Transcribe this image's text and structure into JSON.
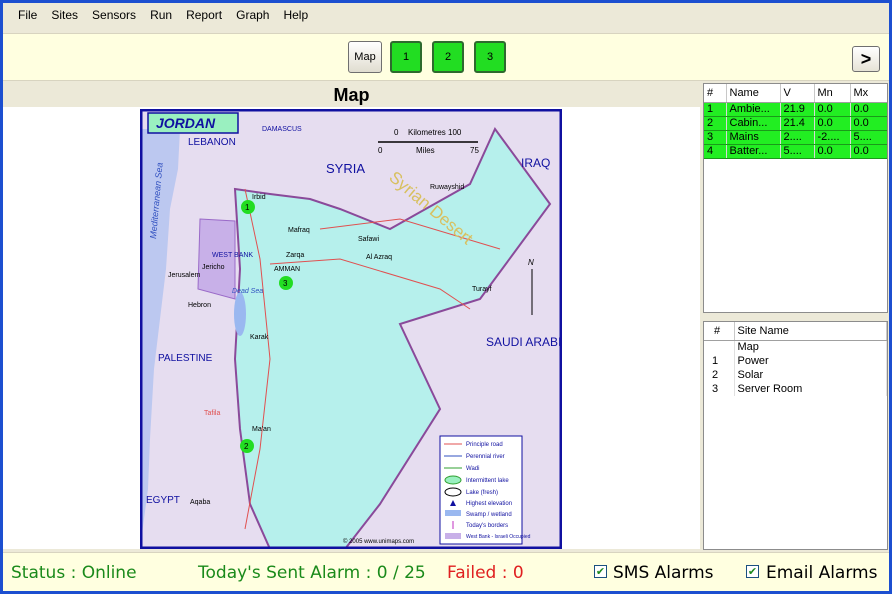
{
  "menu": [
    "File",
    "Sites",
    "Sensors",
    "Run",
    "Report",
    "Graph",
    "Help"
  ],
  "toolbar": {
    "map_label": "Map",
    "site_buttons": [
      "1",
      "2",
      "3"
    ],
    "next_label": ">"
  },
  "map_panel": {
    "title": "Map",
    "map": {
      "country": "JORDAN",
      "labels": {
        "lebanon": "LEBANON",
        "syria": "SYRIA",
        "iraq": "IRAQ",
        "saudi": "SAUDI ARABIA",
        "egypt": "EGYPT",
        "palestine": "PALESTINE",
        "west_bank": "WEST BANK",
        "desert": "Syrian Desert",
        "sea": "Mediterranean Sea",
        "damascus": "DAMASCUS",
        "amman": "AMMAN",
        "dead_sea": "Dead Sea",
        "aqaba": "Aqaba",
        "mafraq": "Mafraq",
        "zarqa": "Zarqa",
        "irbid": "Irbid",
        "karak": "Karak",
        "tafila": "Tafila",
        "maan": "Ma'an",
        "ruwayshid": "Ruwayshid",
        "azraq": "Al Azraq",
        "safawi": "Safawi",
        "turayf": "Turayf",
        "jerusalem": "Jerusalem",
        "jericho": "Jericho",
        "hebron": "Hebron",
        "kilometres": "Kilometres",
        "miles": "Miles",
        "scale_0": "0",
        "scale_100": "100",
        "scale_75": "75",
        "north": "N",
        "copyright": "© 2005 www.unimaps.com"
      },
      "markers": [
        "1",
        "2",
        "3"
      ],
      "legend": [
        "Principle road",
        "Perennial river",
        "Wadi",
        "Intermittent lake",
        "Lake (fresh)",
        "Highest elevation",
        "Swamp / wetland",
        "Today's borders",
        "West Bank - Israeli Occupied"
      ]
    }
  },
  "sensor_table": {
    "headers": [
      "#",
      "Name",
      "V",
      "Mn",
      "Mx"
    ],
    "rows": [
      [
        "1",
        "Ambie...",
        "21.9",
        "0.0",
        "0.0"
      ],
      [
        "2",
        "Cabin...",
        "21.4",
        "0.0",
        "0.0"
      ],
      [
        "3",
        "Mains",
        "2....",
        "-2....",
        "5...."
      ],
      [
        "4",
        "Batter...",
        "5....",
        "0.0",
        "0.0"
      ]
    ],
    "row_color": "#22ee22"
  },
  "site_table": {
    "headers": [
      "#",
      "Site Name"
    ],
    "rows": [
      [
        "",
        "Map"
      ],
      [
        "1",
        "Power"
      ],
      [
        "2",
        "Solar"
      ],
      [
        "3",
        "Server Room"
      ]
    ]
  },
  "status": {
    "status_text": "Status : Online",
    "alarm_text": "Today's Sent Alarm : 0 / 25",
    "failed_text": "Failed : 0",
    "sms_label": "SMS Alarms",
    "sms_checked": true,
    "email_label": "Email Alarms",
    "email_checked": true
  }
}
